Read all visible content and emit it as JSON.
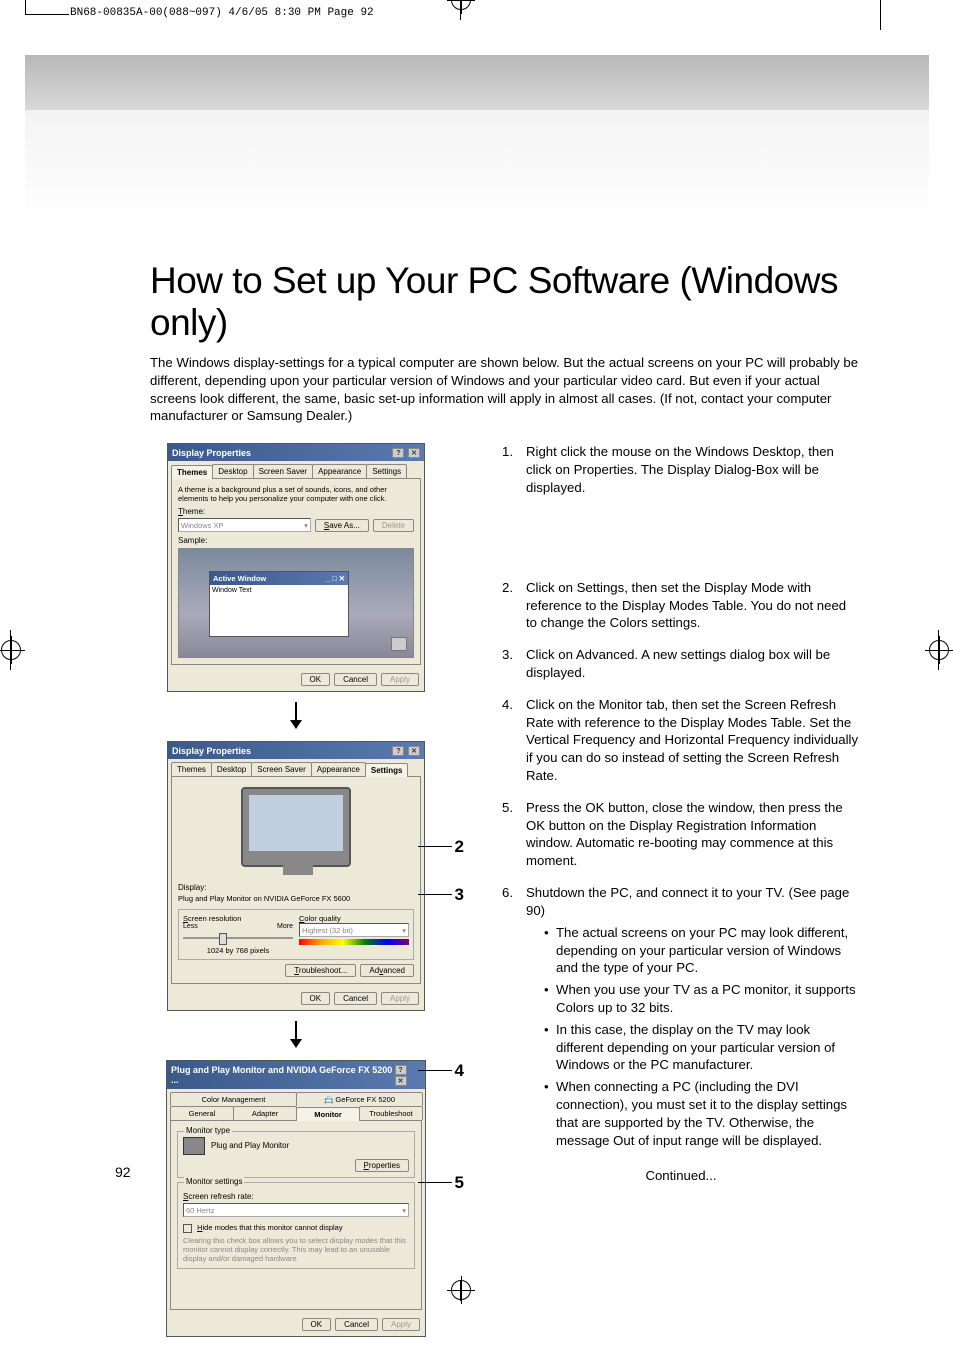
{
  "header_info": "BN68-00835A-00(088~097)  4/6/05  8:30 PM  Page 92",
  "title": "How to Set up Your PC Software (Windows only)",
  "intro": "The Windows display-settings for a typical computer are shown below. But the actual screens on your PC will probably be different, depending upon your particular version of Windows and your particular video card. But even if your actual screens look different, the same, basic set-up information will apply in almost all cases. (If not, contact your computer manufacturer or Samsung Dealer.)",
  "page_number": "92",
  "continued": "Continued...",
  "callouts": [
    "2",
    "3",
    "4",
    "5"
  ],
  "steps": [
    {
      "num": "1.",
      "text": "Right click the mouse on the Windows Desktop, then click on Properties. The Display Dialog-Box will be displayed."
    },
    {
      "num": "2.",
      "text": "Click on Settings, then set the Display Mode with reference to the Display Modes Table. You do not need to change the Colors settings."
    },
    {
      "num": "3.",
      "text": "Click on Advanced. A new settings dialog box will be displayed."
    },
    {
      "num": "4.",
      "text": "Click on the Monitor tab, then set the Screen Refresh Rate with reference to the Display Modes Table. Set the Vertical Frequency and Horizontal Frequency individually if you can do so instead of setting the Screen Refresh Rate."
    },
    {
      "num": "5.",
      "text": "Press the OK button, close the window, then press the OK button on the Display Registration Information window. Automatic re-booting may commence at this moment."
    },
    {
      "num": "6.",
      "text": "Shutdown the PC, and connect it to your TV. (See page 90)"
    }
  ],
  "bullets": [
    "The actual screens on your PC may look different, depending on your particular version of Windows and the type of your PC.",
    "When you use your TV as a PC monitor, it supports Colors up to 32 bits.",
    "In this case, the display on the TV may look different depending on your particular version of Windows or the PC manufacturer.",
    "When connecting a PC (including the DVI connection), you must set it to the display settings that are supported by the TV. Otherwise, the message Out of input range will be displayed."
  ],
  "dlg1": {
    "title": "Display Properties",
    "tabs": [
      "Themes",
      "Desktop",
      "Screen Saver",
      "Appearance",
      "Settings"
    ],
    "active_tab": 0,
    "desc": "A theme is a background plus a set of sounds, icons, and other elements to help you personalize your computer with one click.",
    "theme_label": "Theme:",
    "theme_value": "Windows XP",
    "save_as": "Save As...",
    "delete": "Delete",
    "sample_label": "Sample:",
    "active_window": "Active Window",
    "window_text": "Window Text",
    "ok": "OK",
    "cancel": "Cancel",
    "apply": "Apply"
  },
  "dlg2": {
    "title": "Display Properties",
    "tabs": [
      "Themes",
      "Desktop",
      "Screen Saver",
      "Appearance",
      "Settings"
    ],
    "active_tab": 4,
    "display_label": "Display:",
    "display_value": "Plug and Play Monitor on NVIDIA GeForce FX 5600",
    "res_label": "Screen resolution",
    "less": "Less",
    "more": "More",
    "res_value": "1024 by 768 pixels",
    "color_label": "Color quality",
    "color_value": "Highest (32 bit)",
    "troubleshoot": "Troubleshoot...",
    "advanced": "Advanced",
    "ok": "OK",
    "cancel": "Cancel",
    "apply": "Apply"
  },
  "dlg3": {
    "title": "Plug and Play Monitor and NVIDIA GeForce FX 5200 ...",
    "row1": [
      "Color Management",
      "GeForce FX 5200"
    ],
    "row2": [
      "General",
      "Adapter",
      "Monitor",
      "Troubleshoot"
    ],
    "active_tab": "Monitor",
    "mtype_label": "Monitor type",
    "mtype_value": "Plug and Play Monitor",
    "properties": "Properties",
    "msettings_label": "Monitor settings",
    "refresh_label": "Screen refresh rate:",
    "refresh_value": "60 Hertz",
    "hide_label": "Hide modes that this monitor cannot display",
    "hide_desc": "Clearing this check box allows you to select display modes that this monitor cannot display correctly. This may lead to an unusable display and/or damaged hardware.",
    "ok": "OK",
    "cancel": "Cancel",
    "apply": "Apply"
  }
}
